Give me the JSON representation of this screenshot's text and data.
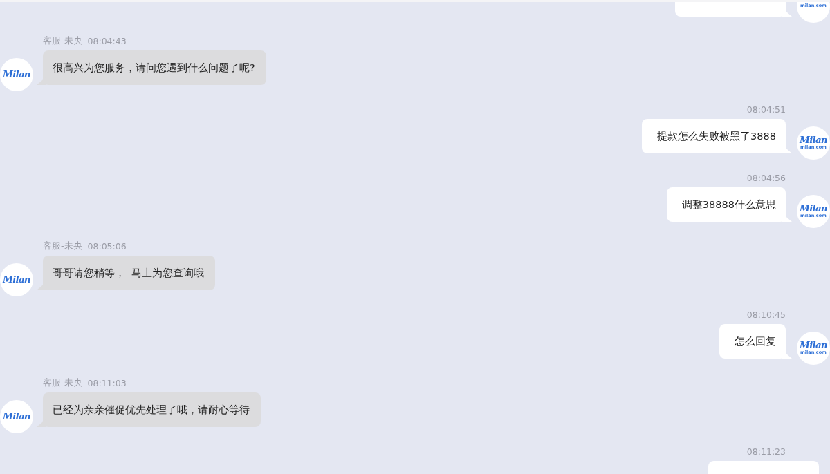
{
  "messages": [
    {
      "kind": "customer",
      "avatar": {
        "domain": "milan.com"
      }
    },
    {
      "kind": "agent",
      "sender": "客服-未央",
      "time": "08:04:43",
      "text": "很高兴为您服务，请问您遇到什么问题了呢?",
      "avatar": {
        "logo": "Milan"
      }
    },
    {
      "kind": "customer",
      "time": "08:04:51",
      "text": "提款怎么失败被黑了3888",
      "avatar": {
        "logo": "Milan",
        "domain": "milan.com"
      }
    },
    {
      "kind": "customer",
      "time": "08:04:56",
      "text": "调整38888什么意思",
      "avatar": {
        "logo": "Milan",
        "domain": "milan.com"
      }
    },
    {
      "kind": "agent",
      "sender": "客服-未央",
      "time": "08:05:06",
      "text": "哥哥请您稍等，  马上为您查询哦",
      "avatar": {
        "logo": "Milan"
      }
    },
    {
      "kind": "customer",
      "time": "08:10:45",
      "text": "怎么回复",
      "avatar": {
        "logo": "Milan",
        "domain": "milan.com"
      }
    },
    {
      "kind": "agent",
      "sender": "客服-未央",
      "time": "08:11:03",
      "text": "已经为亲亲催促优先处理了哦，请耐心等待",
      "avatar": {
        "logo": "Milan"
      }
    },
    {
      "kind": "customer",
      "time": "08:11:23"
    }
  ]
}
